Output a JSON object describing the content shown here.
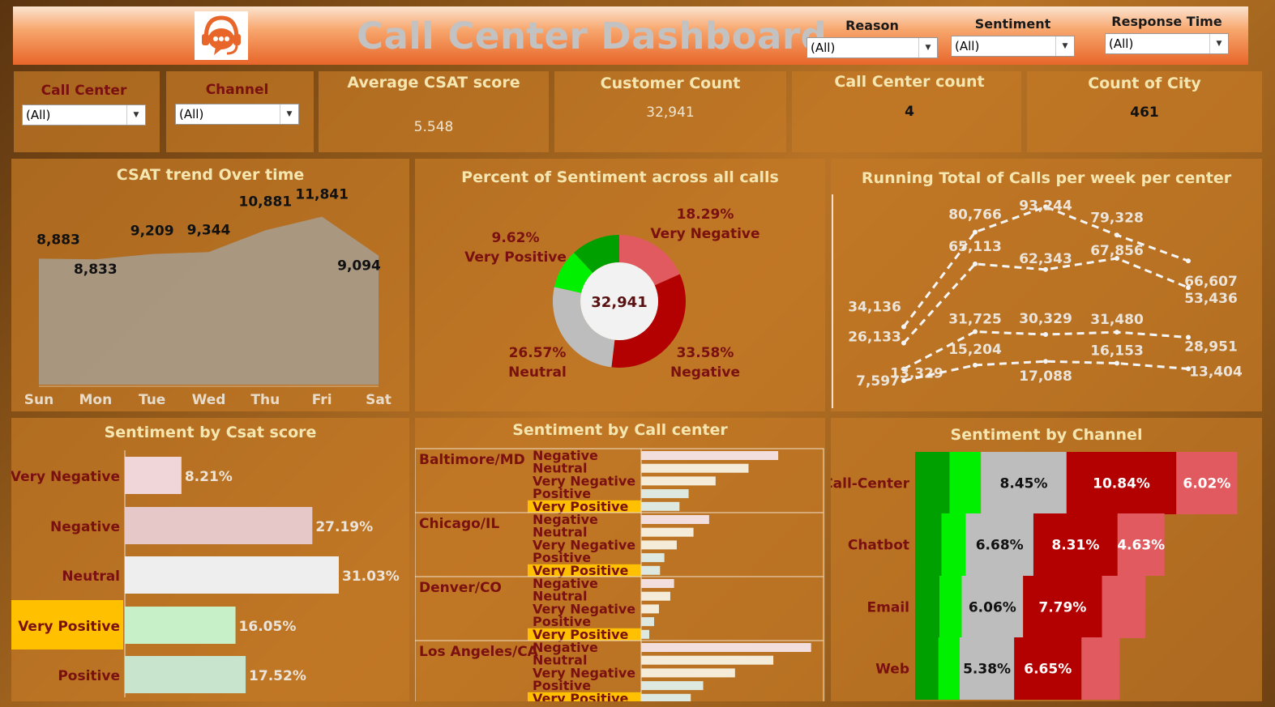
{
  "header": {
    "title": "Call Center Dashboard",
    "filters": [
      {
        "label": "Reason",
        "value": "(All)"
      },
      {
        "label": "Sentiment",
        "value": "(All)"
      },
      {
        "label": "Response Time",
        "value": "(All)"
      }
    ]
  },
  "side_filters": [
    {
      "label": "Call Center",
      "value": "(All)"
    },
    {
      "label": "Channel",
      "value": "(All)"
    }
  ],
  "kpis": [
    {
      "title": "Average CSAT score",
      "value": "5.548"
    },
    {
      "title": "Customer Count",
      "value": "32,941"
    },
    {
      "title": "Call Center count",
      "value": "4"
    },
    {
      "title": "Count of City",
      "value": "461"
    }
  ],
  "colors": {
    "very_negative": "#e05a5f",
    "negative": "#b30000",
    "neutral": "#bdbdbd",
    "very_positive": "#00f000",
    "positive": "#00a000",
    "highlight": "#ffc000",
    "title_text": "#f5e6b0",
    "label_dark": "#7a1010"
  },
  "icons": {
    "logo": "headset-chat-icon",
    "dropdown": "caret-down-icon"
  },
  "chart_data": [
    {
      "id": "csat_trend",
      "type": "area",
      "title": "CSAT trend Over time",
      "categories": [
        "Sun",
        "Mon",
        "Tue",
        "Wed",
        "Thu",
        "Fri",
        "Sat"
      ],
      "values": [
        8883,
        8833,
        9209,
        9344,
        10881,
        11841,
        9094
      ],
      "labels": [
        "8,883",
        "8,833",
        "9,209",
        "9,344",
        "10,881",
        "11,841",
        "9,094"
      ]
    },
    {
      "id": "sentiment_donut",
      "type": "pie",
      "title": "Percent of Sentiment across all calls",
      "center_label": "32,941",
      "slices": [
        {
          "name": "Very Negative",
          "pct": "18.29%",
          "value": 18.29
        },
        {
          "name": "Negative",
          "pct": "33.58%",
          "value": 33.58
        },
        {
          "name": "Neutral",
          "pct": "26.57%",
          "value": 26.57
        },
        {
          "name": "Very Positive",
          "pct": "9.62%",
          "value": 9.62
        },
        {
          "name": "Positive",
          "pct": "",
          "value": 11.94
        }
      ]
    },
    {
      "id": "running_total",
      "type": "line",
      "title": "Running Total of Calls per week per center",
      "series": [
        {
          "values": [
            34136,
            80766,
            93244,
            79328,
            66607
          ],
          "labels": [
            "34,136",
            "80,766",
            "93,244",
            "79,328",
            "66,607"
          ]
        },
        {
          "values": [
            26133,
            65113,
            62343,
            67856,
            53436
          ],
          "labels": [
            "26,133",
            "65,113",
            "62,343",
            "67,856",
            "53,436"
          ]
        },
        {
          "values": [
            13329,
            31725,
            30329,
            31480,
            28951
          ],
          "labels": [
            "13,329",
            "31,725",
            "30,329",
            "31,480",
            "28,951"
          ]
        },
        {
          "values": [
            7597,
            15204,
            17088,
            16153,
            13404
          ],
          "labels": [
            "7,597",
            "15,204",
            "17,088",
            "16,153",
            "13,404"
          ]
        }
      ]
    },
    {
      "id": "sentiment_by_csat",
      "type": "bar",
      "title": "Sentiment by Csat score",
      "categories": [
        "Very Negative",
        "Negative",
        "Neutral",
        "Very Positive",
        "Positive"
      ],
      "values": [
        8.21,
        27.19,
        31.03,
        16.05,
        17.52
      ],
      "labels": [
        "8.21%",
        "27.19%",
        "31.03%",
        "16.05%",
        "17.52%"
      ],
      "highlight": "Very Positive"
    },
    {
      "id": "sentiment_by_call_center",
      "type": "bar",
      "title": "Sentiment by Call center",
      "sentiments": [
        "Negative",
        "Neutral",
        "Very Negative",
        "Positive",
        "Very Positive"
      ],
      "centers": [
        {
          "name": "Baltimore/MD",
          "values": [
            1270,
            995,
            690,
            440,
            355
          ]
        },
        {
          "name": "Chicago/IL",
          "values": [
            630,
            485,
            330,
            215,
            175
          ]
        },
        {
          "name": "Denver/CO",
          "values": [
            305,
            270,
            165,
            120,
            75
          ]
        },
        {
          "name": "Los Angeles/CA",
          "values": [
            1575,
            1225,
            870,
            575,
            460
          ]
        }
      ]
    },
    {
      "id": "sentiment_by_channel",
      "type": "bar",
      "title": "Sentiment by Channel",
      "stack_order": [
        "Positive",
        "Very Positive",
        "Neutral",
        "Negative",
        "Very Negative"
      ],
      "channels": [
        {
          "name": "Call-Center",
          "values": [
            3.4,
            3.1,
            8.45,
            10.84,
            6.02
          ],
          "labels": [
            "",
            "",
            "8.45%",
            "10.84%",
            "6.02%"
          ]
        },
        {
          "name": "Chatbot",
          "values": [
            2.6,
            2.4,
            6.68,
            8.31,
            4.63
          ],
          "labels": [
            "",
            "",
            "6.68%",
            "8.31%",
            "4.63%"
          ]
        },
        {
          "name": "Email",
          "values": [
            2.4,
            2.2,
            6.06,
            7.79,
            4.27
          ],
          "labels": [
            "",
            "",
            "6.06%",
            "7.79%",
            ""
          ]
        },
        {
          "name": "Web",
          "values": [
            2.3,
            2.1,
            5.38,
            6.65,
            3.76
          ],
          "labels": [
            "",
            "",
            "5.38%",
            "6.65%",
            ""
          ]
        }
      ]
    }
  ]
}
